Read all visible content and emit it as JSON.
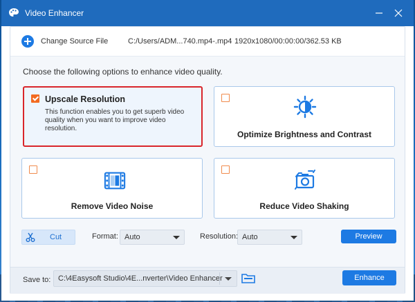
{
  "window": {
    "title": "Video Enhancer",
    "icons": {
      "app": "palette-icon",
      "minimize": "minimize-icon",
      "close": "close-icon"
    }
  },
  "source": {
    "change_label": "Change Source File",
    "file_path": "C:/Users/ADM...740.mp4-.mp4",
    "file_info": "1920x1080/00:00:00/362.53 KB",
    "icon": "plus-circle-icon"
  },
  "intro": "Choose the following options to enhance video quality.",
  "options": [
    {
      "title": "Upscale Resolution",
      "description": "This function enables you to get superb video quality when you want to improve video resolution.",
      "checked": true,
      "icon": ""
    },
    {
      "title": "Optimize Brightness and Contrast",
      "checked": false,
      "icon": "brightness-icon"
    },
    {
      "title": "Remove Video Noise",
      "checked": false,
      "icon": "film-strip-icon"
    },
    {
      "title": "Reduce Video Shaking",
      "checked": false,
      "icon": "stabilize-camera-icon"
    }
  ],
  "controls": {
    "cut_label": "Cut",
    "format_label": "Format:",
    "format_value": "Auto",
    "resolution_label": "Resolution:",
    "resolution_value": "Auto",
    "preview_label": "Preview"
  },
  "save": {
    "label": "Save to:",
    "path": "C:\\4Easysoft Studio\\4E...nverter\\Video Enhancer",
    "enhance_label": "Enhance"
  },
  "colors": {
    "accent": "#1d7ae3",
    "titlebar": "#1f6bbd",
    "checkbox": "#f26a21",
    "selected_border": "#d9252a"
  }
}
